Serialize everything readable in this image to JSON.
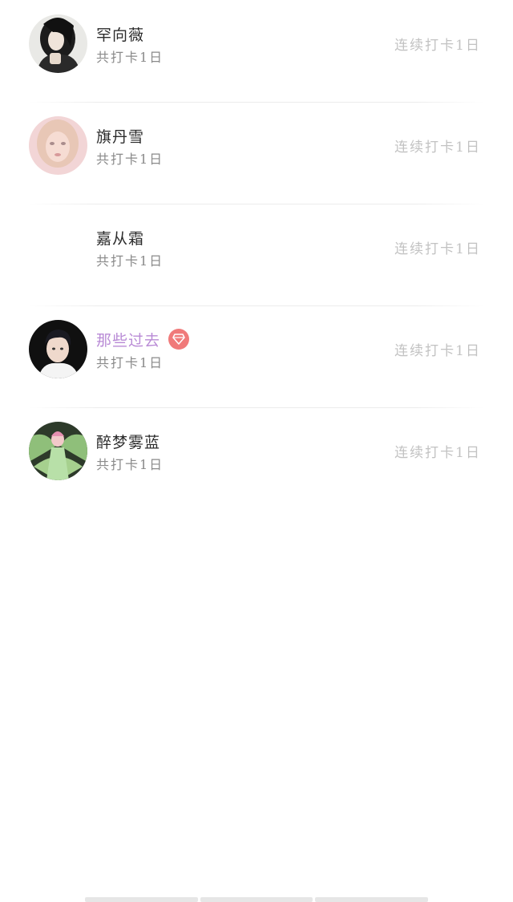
{
  "users": [
    {
      "name": "罕向薇",
      "total": "共打卡1日",
      "streak": "连续打卡1日",
      "avatar": "dark-hair-woman",
      "vip": false
    },
    {
      "name": "旗丹雪",
      "total": "共打卡1日",
      "streak": "连续打卡1日",
      "avatar": "pink-tint-girl",
      "vip": false
    },
    {
      "name": "嘉从霜",
      "total": "共打卡1日",
      "streak": "连续打卡1日",
      "avatar": "none",
      "vip": false
    },
    {
      "name": "那些过去",
      "total": "共打卡1日",
      "streak": "连续打卡1日",
      "avatar": "young-man-white-hoodie",
      "vip": true,
      "badge_icon": "diamond-icon"
    },
    {
      "name": "醉梦雾蓝",
      "total": "共打卡1日",
      "streak": "连续打卡1日",
      "avatar": "fairy-green-wings",
      "vip": false
    }
  ],
  "colors": {
    "vip_name": "#b98bd6",
    "badge": "#f07a7a",
    "name": "#2b2b2b",
    "total": "#8a8a8a",
    "streak": "#c2c2c2"
  }
}
